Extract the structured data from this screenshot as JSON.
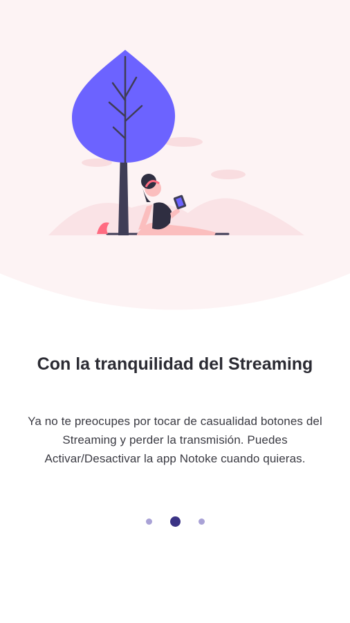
{
  "onboarding": {
    "title": "Con la tranquilidad del Streaming",
    "description": "Ya no te preocupes por tocar de casualidad botones del Streaming y perder la transmisión. Puedes Activar/Desactivar la app Notoke cuando quieras.",
    "illustration": "woman-under-tree-illustration",
    "pager": {
      "total_pages": 3,
      "current_page": 2
    }
  },
  "colors": {
    "hero_background": "#fdf3f4",
    "tree_canopy": "#6c63ff",
    "tree_trunk": "#3f3d56",
    "hills": "#f9dde0",
    "accent_plant": "#ff6b81",
    "dot_active": "#3a3385",
    "dot_inactive": "#a9a2d6",
    "title_text": "#2b2b33",
    "body_text": "#3a3a42"
  }
}
